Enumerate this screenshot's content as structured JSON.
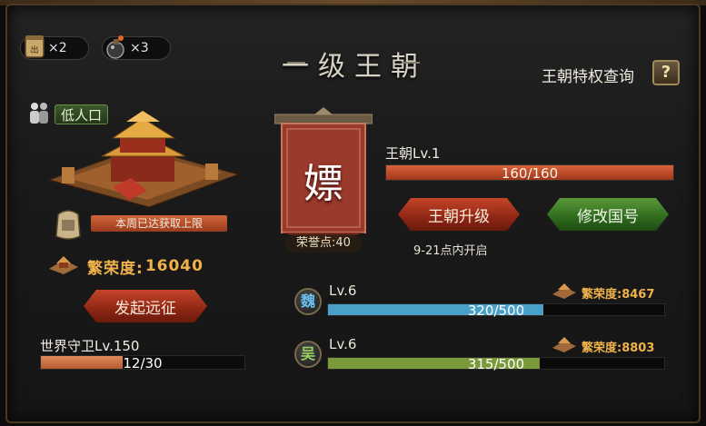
{
  "resources": [
    {
      "icon": "scroll-icon",
      "count": "×2"
    },
    {
      "icon": "bomb-icon",
      "count": "×3"
    }
  ],
  "title": "一级王朝",
  "privilege_query": "王朝特权查询",
  "help_symbol": "?",
  "left": {
    "population_label": "低人口",
    "weekly_limit": "本周已达获取上限",
    "prosperity_label": "繁荣度:",
    "prosperity_value": "16040",
    "expedition_button": "发起远征",
    "world_guard_label": "世界守卫Lv.150",
    "world_guard_progress": "12/30",
    "world_guard_ratio": 0.4
  },
  "dynasty": {
    "banner_char": "嫖",
    "honor_points": "荣誉点:40",
    "level_label": "王朝Lv.1",
    "progress_text": "160/160",
    "progress_ratio": 1.0,
    "upgrade_button": "王朝升级",
    "rename_button": "修改国号",
    "open_note": "9-21点内开启"
  },
  "kingdoms": [
    {
      "glyph": "魏",
      "level": "Lv.6",
      "progress": "320/500",
      "ratio": 0.64,
      "prosperity": "繁荣度:8467",
      "color": "#4aa0c8"
    },
    {
      "glyph": "吴",
      "level": "Lv.6",
      "progress": "315/500",
      "ratio": 0.63,
      "prosperity": "繁荣度:8803",
      "color": "#7a9a3a"
    }
  ],
  "colors": {
    "accent_gold": "#f0b24a",
    "bar_red": "#c8502c",
    "bar_blue": "#4aa0c8",
    "bar_green": "#7a9a3a"
  }
}
